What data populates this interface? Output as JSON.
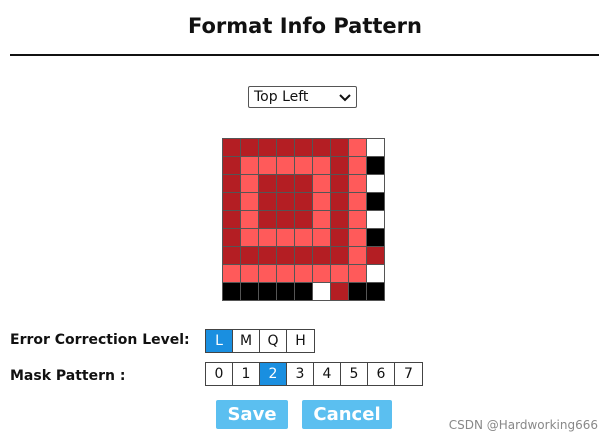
{
  "header": {
    "title": "Format Info Pattern"
  },
  "position_select": {
    "value": "Top Left"
  },
  "pattern": {
    "colors": {
      "dark": "#b41e23",
      "light": "#ff5a5a",
      "black": "#000000",
      "white": "#ffffff"
    },
    "rows": [
      [
        "dark",
        "dark",
        "dark",
        "dark",
        "dark",
        "dark",
        "dark",
        "light",
        "white"
      ],
      [
        "dark",
        "light",
        "light",
        "light",
        "light",
        "light",
        "dark",
        "light",
        "black"
      ],
      [
        "dark",
        "light",
        "dark",
        "dark",
        "dark",
        "light",
        "dark",
        "light",
        "white"
      ],
      [
        "dark",
        "light",
        "dark",
        "dark",
        "dark",
        "light",
        "dark",
        "light",
        "black"
      ],
      [
        "dark",
        "light",
        "dark",
        "dark",
        "dark",
        "light",
        "dark",
        "light",
        "white"
      ],
      [
        "dark",
        "light",
        "light",
        "light",
        "light",
        "light",
        "dark",
        "light",
        "black"
      ],
      [
        "dark",
        "dark",
        "dark",
        "dark",
        "dark",
        "dark",
        "dark",
        "light",
        "dark"
      ],
      [
        "light",
        "light",
        "light",
        "light",
        "light",
        "light",
        "light",
        "light",
        "white"
      ],
      [
        "black",
        "black",
        "black",
        "black",
        "black",
        "white",
        "dark",
        "black",
        "black"
      ]
    ]
  },
  "error_correction": {
    "label": "Error Correction Level:",
    "options": [
      "L",
      "M",
      "Q",
      "H"
    ],
    "selected": "L"
  },
  "mask_pattern": {
    "label": "Mask Pattern :",
    "options": [
      "0",
      "1",
      "2",
      "3",
      "4",
      "5",
      "6",
      "7"
    ],
    "selected": "2"
  },
  "actions": {
    "save": "Save",
    "cancel": "Cancel"
  },
  "watermark": "CSDN @Hardworking666"
}
